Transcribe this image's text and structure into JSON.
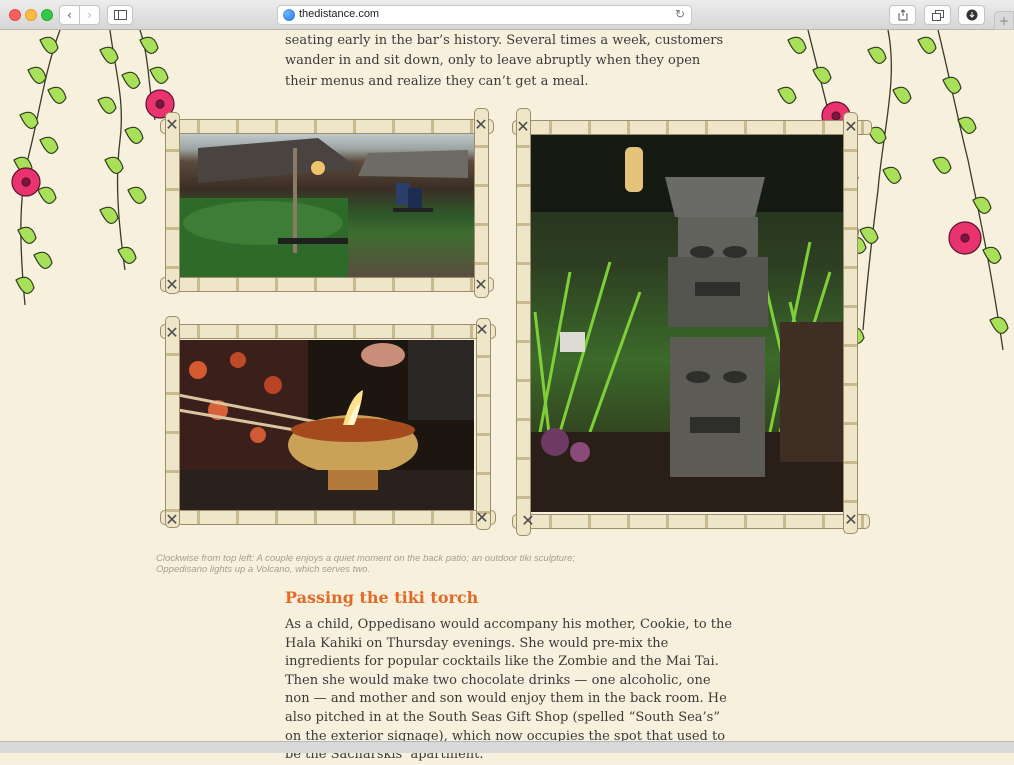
{
  "browser": {
    "url": "thedistance.com",
    "back_icon": "chevron-left",
    "forward_icon": "chevron-right",
    "sidebar_icon": "sidebar",
    "share_icon": "share",
    "tabs_icon": "tabs",
    "downloads_icon": "download",
    "new_tab_label": "+"
  },
  "article": {
    "paragraph_top": "seating early in the bar’s history. Several times a week, customers wander in and sit down, only to leave abruptly when they open their menus and realize they can’t get a meal.",
    "caption": "Clockwise from top left: A couple enjoys a quiet moment on the back patio; an outdoor tiki sculpture; Oppedisano lights up a Volcano, which serves two.",
    "section_heading": "Passing the tiki torch",
    "paragraph_body": "As a child, Oppedisano would accompany his mother, Cookie, to the Hala Kahiki on Thursday evenings. She would pre-mix the ingredients for popular cocktails like the Zombie and the Mai Tai. Then she would make two chocolate drinks — one alcoholic, one non — and mother and son would enjoy them in the back room. He also pitched in at the South Seas Gift Shop (spelled “South Sea’s” on the exterior signage), which now occupies the spot that used to be the Sacharskis’ apartment."
  },
  "colors": {
    "page_bg": "#f7f0dc",
    "heading": "#e06a2a",
    "body_text": "#3a3a3a",
    "caption": "#a49e8e"
  }
}
